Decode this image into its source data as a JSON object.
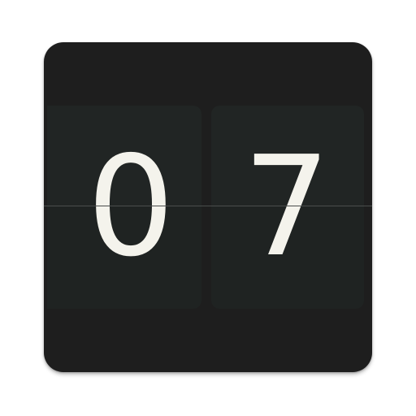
{
  "clock": {
    "left_digit": "0",
    "right_digit": "7"
  },
  "colors": {
    "background": "#1e1e1e",
    "card": "#1f2322",
    "digit": "#f4f3ec",
    "split_line": "#4a4d4c"
  }
}
